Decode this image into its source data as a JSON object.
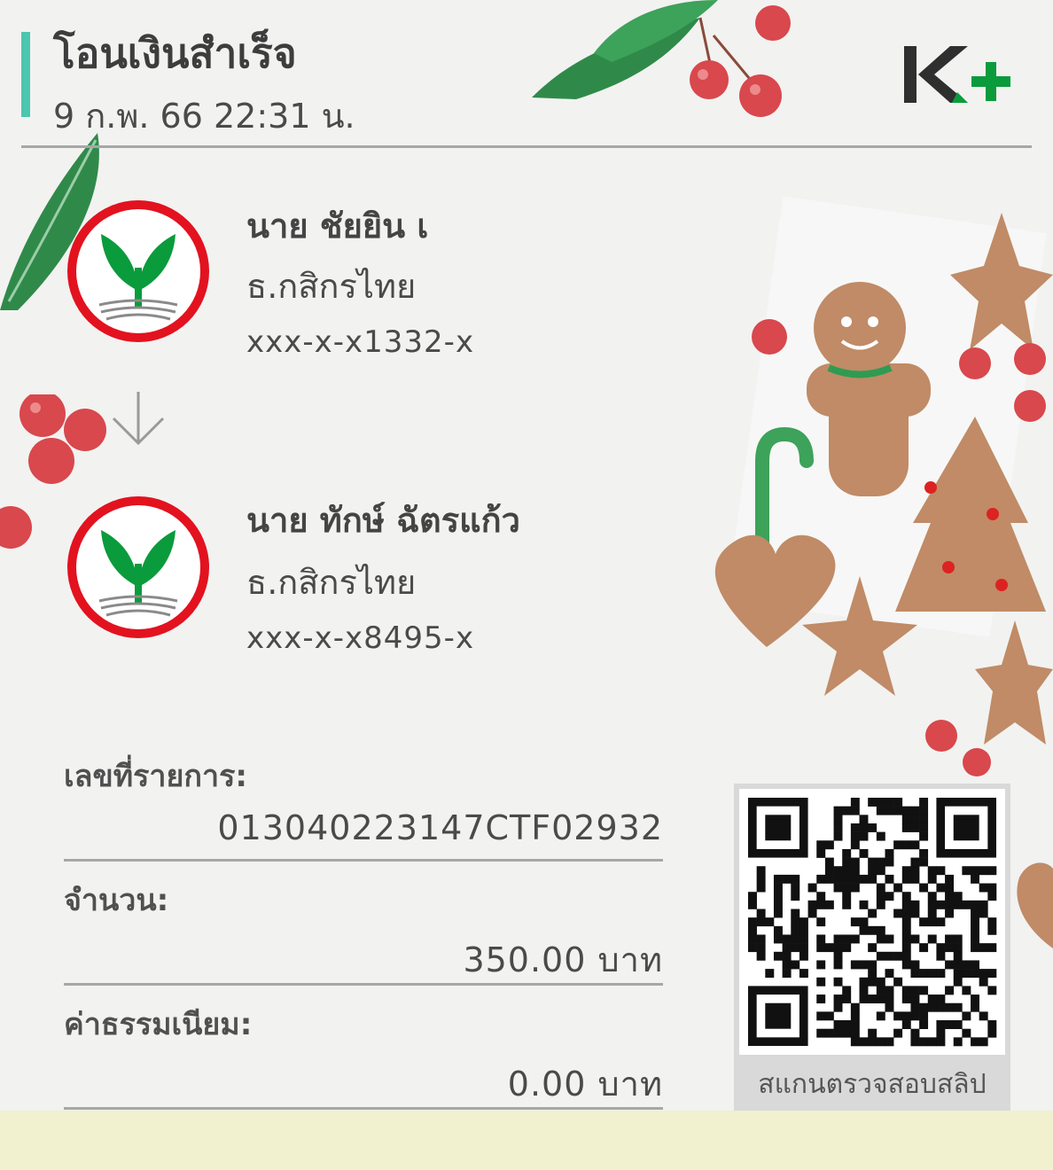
{
  "header": {
    "title": "โอนเงินสำเร็จ",
    "datetime": "9 ก.พ. 66  22:31 น.",
    "logo_text": "K+"
  },
  "sender": {
    "name": "นาย ชัยยิน เ",
    "bank": "ธ.กสิกรไทย",
    "account": "xxx-x-x1332-x",
    "icon": "kbank-logo-icon"
  },
  "receiver": {
    "name": "นาย ทักษ์ ฉัตรแก้ว",
    "bank": "ธ.กสิกรไทย",
    "account": "xxx-x-x8495-x",
    "icon": "kbank-logo-icon"
  },
  "details": {
    "ref_label": "เลขที่รายการ:",
    "ref_value": "013040223147CTF02932",
    "amount_label": "จำนวน:",
    "amount_value": "350.00 บาท",
    "fee_label": "ค่าธรรมเนียม:",
    "fee_value": "0.00 บาท"
  },
  "qr": {
    "caption": "สแกนตรวจสอบสลิป",
    "icon": "qr-code-icon"
  },
  "colors": {
    "accent": "#4cc6ae",
    "kbank_green": "#0a9b3c",
    "kbank_red": "#e3121f",
    "logo_dark": "#2f2f2f",
    "footer": "#f1f0cf"
  }
}
